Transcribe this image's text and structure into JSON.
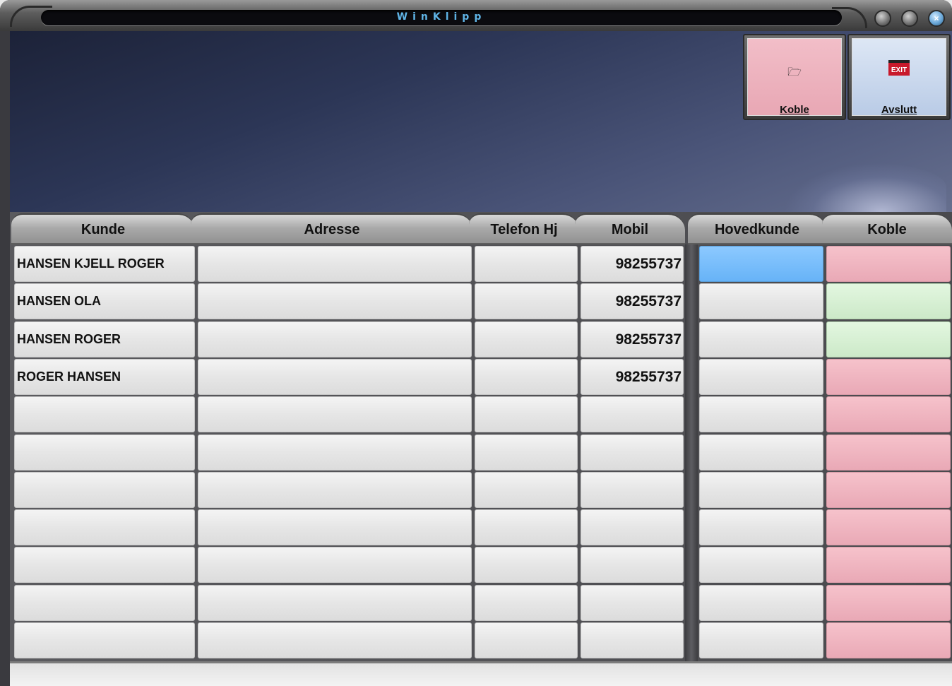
{
  "window": {
    "title": "WinKlipp"
  },
  "actions": {
    "koble": {
      "label": "Koble",
      "icon": "folder-open-icon"
    },
    "avslutt": {
      "label": "Avslutt",
      "icon": "exit-sign-icon",
      "sign_text": "EXIT"
    }
  },
  "columns": [
    "Kunde",
    "Adresse",
    "Telefon Hj",
    "Mobil",
    "Hovedkunde",
    "Koble"
  ],
  "rows": [
    {
      "kunde": "HANSEN KJELL ROGER",
      "adresse": "",
      "telefon": "",
      "mobil": "98255737",
      "hovedkunde_state": "blue",
      "koble_state": "pink"
    },
    {
      "kunde": " HANSEN OLA",
      "adresse": "",
      "telefon": "",
      "mobil": "98255737",
      "hovedkunde_state": "none",
      "koble_state": "green"
    },
    {
      "kunde": "HANSEN ROGER",
      "adresse": "",
      "telefon": "",
      "mobil": "98255737",
      "hovedkunde_state": "none",
      "koble_state": "green"
    },
    {
      "kunde": "ROGER HANSEN",
      "adresse": "",
      "telefon": "",
      "mobil": "98255737",
      "hovedkunde_state": "none",
      "koble_state": "pink"
    },
    {
      "kunde": "",
      "adresse": "",
      "telefon": "",
      "mobil": "",
      "hovedkunde_state": "none",
      "koble_state": "pink"
    },
    {
      "kunde": "",
      "adresse": "",
      "telefon": "",
      "mobil": "",
      "hovedkunde_state": "none",
      "koble_state": "pink"
    },
    {
      "kunde": "",
      "adresse": "",
      "telefon": "",
      "mobil": "",
      "hovedkunde_state": "none",
      "koble_state": "pink"
    },
    {
      "kunde": "",
      "adresse": "",
      "telefon": "",
      "mobil": "",
      "hovedkunde_state": "none",
      "koble_state": "pink"
    },
    {
      "kunde": "",
      "adresse": "",
      "telefon": "",
      "mobil": "",
      "hovedkunde_state": "none",
      "koble_state": "pink"
    },
    {
      "kunde": "",
      "adresse": "",
      "telefon": "",
      "mobil": "",
      "hovedkunde_state": "none",
      "koble_state": "pink"
    },
    {
      "kunde": "",
      "adresse": "",
      "telefon": "",
      "mobil": "",
      "hovedkunde_state": "none",
      "koble_state": "pink"
    }
  ],
  "state_colors": {
    "blue": "#67b3f7",
    "pink": "#e9a9b6",
    "green": "#cce9c8"
  }
}
